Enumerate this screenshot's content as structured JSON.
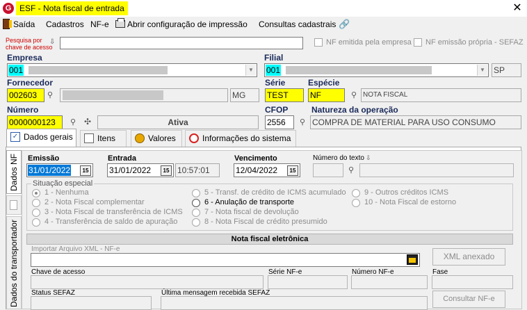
{
  "window": {
    "title": "ESF - Nota fiscal de entrada",
    "logo_letter": "G",
    "close_glyph": "✕"
  },
  "menu": {
    "saida": "Saída",
    "cadastros": "Cadastros",
    "nfe": "NF-e",
    "impressao": "Abrir configuração de impressão",
    "consultas": "Consultas cadastrais"
  },
  "search": {
    "label_line1": "Pesquisa por",
    "label_line2": "chave de acesso",
    "value": "",
    "chk_emitida": "NF emitida pela empresa",
    "chk_propria": "NF emissão própria - SEFAZ"
  },
  "empresa": {
    "label": "Empresa",
    "code": "001"
  },
  "filial": {
    "label": "Filial",
    "code": "001",
    "uf": "SP"
  },
  "fornecedor": {
    "label": "Fornecedor",
    "code": "002603",
    "uf": "MG"
  },
  "serie": {
    "label": "Série",
    "value": "TEST"
  },
  "especie": {
    "label": "Espécie",
    "value": "NF",
    "description": "NOTA FISCAL"
  },
  "numero": {
    "label": "Número",
    "value": "0000000123",
    "status": "Ativa"
  },
  "cfop": {
    "label": "CFOP",
    "value": "2556"
  },
  "natureza": {
    "label": "Natureza da operação",
    "value": "COMPRA DE MATERIAL PARA USO CONSUMO"
  },
  "tabs": {
    "dados_gerais": "Dados gerais",
    "itens": "Itens",
    "valores": "Valores",
    "info_sistema": "Informações do sistema"
  },
  "vtabs": {
    "dados_nf": "Dados NF",
    "transportador": "Dados do transportador"
  },
  "dates": {
    "emissao_label": "Emissão",
    "emissao": "31/01/2022",
    "entrada_label": "Entrada",
    "entrada": "31/01/2022",
    "entrada_hora": "10:57:01",
    "vencimento_label": "Vencimento",
    "vencimento": "12/04/2022",
    "numero_texto_label": "Número do texto",
    "cal_glyph": "15"
  },
  "situacao": {
    "title": "Situação especial",
    "options": [
      "1 - Nenhuma",
      "2 - Nota Fiscal complementar",
      "3 - Nota Fiscal de transferência de ICMS",
      "4 - Transferência de saldo de apuração",
      "5 - Transf. de crédito de ICMS acumulado",
      "6 - Anulação de transporte",
      "7 - Nota fiscal de devolução",
      "8 - Nota Fiscal de crédito presumido",
      "9 - Outros créditos ICMS",
      "10 - Nota Fiscal de estorno"
    ]
  },
  "nfe": {
    "header": "Nota fiscal eletrônica",
    "importar_label": "Importar Arquivo XML - NF-e",
    "xml_button": "XML anexado",
    "chave_label": "Chave de acesso",
    "serie_label": "Série NF-e",
    "numero_label": "Número NF-e",
    "fase_label": "Fase",
    "status_label": "Status SEFAZ",
    "ultima_msg_label": "Última mensagem recebida SEFAZ",
    "consultar_button": "Consultar NF-e"
  },
  "colors": {
    "highlight": "#ffff00",
    "code_cyan": "#00ffff",
    "selection": "#0078d7",
    "required_red": "#d00000"
  }
}
